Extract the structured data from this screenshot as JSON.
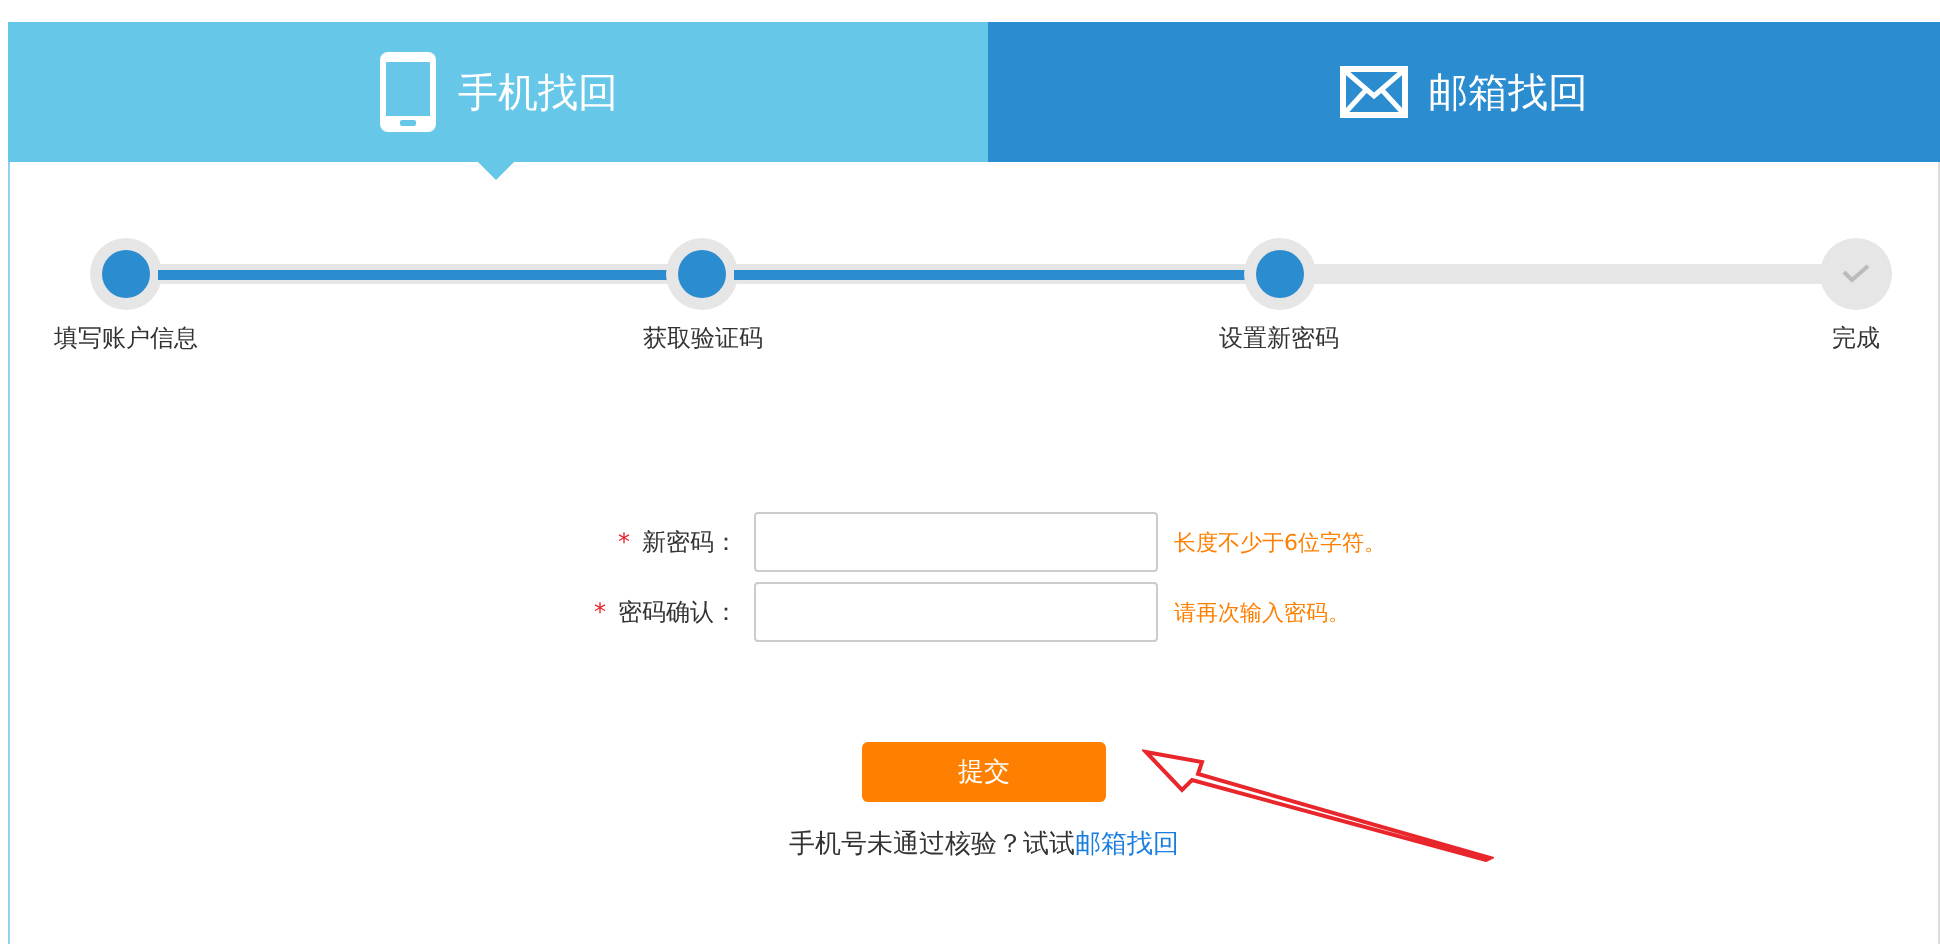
{
  "tabs": [
    {
      "label": "手机找回",
      "kind": "phone",
      "selected": true
    },
    {
      "label": "邮箱找回",
      "kind": "mail",
      "selected": false
    }
  ],
  "steps": [
    {
      "label": "填写账户信息",
      "done": true
    },
    {
      "label": "获取验证码",
      "done": true
    },
    {
      "label": "设置新密码",
      "done": true
    },
    {
      "label": "完成",
      "done": false
    }
  ],
  "fields": [
    {
      "required_mark": "*",
      "label": "新密码：",
      "hint": "长度不少于6位字符。"
    },
    {
      "required_mark": "*",
      "label": "密码确认：",
      "hint": "请再次输入密码。"
    }
  ],
  "submit_button": "提交",
  "footer": {
    "text": "手机号未通过核验？试试",
    "link": "邮箱找回"
  }
}
